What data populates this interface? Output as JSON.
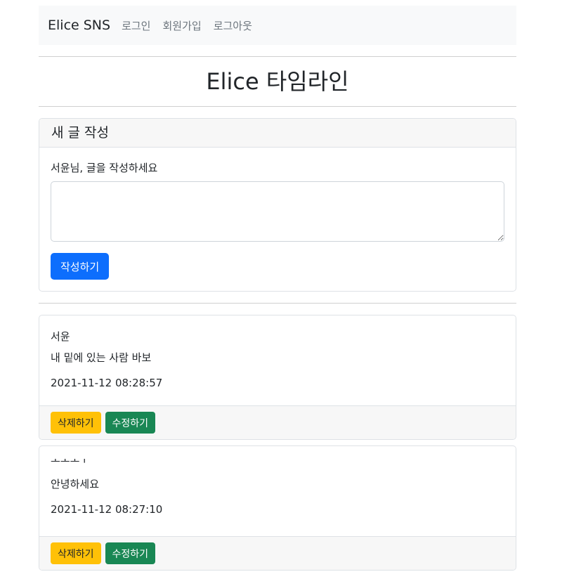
{
  "navbar": {
    "brand": "Elice SNS",
    "links": [
      "로그인",
      "회원가입",
      "로그아웃"
    ]
  },
  "page": {
    "title": "Elice 타임라인"
  },
  "new_post": {
    "header": "새 글 작성",
    "label": "서윤님, 글을 작성하세요",
    "textarea_value": "",
    "submit_label": "작성하기"
  },
  "posts": [
    {
      "author": "서윤",
      "content": "내 밑에 있는 사람 바보",
      "date": "2021-11-12 08:28:57",
      "delete_label": "삭제하기",
      "edit_label": "수정하기"
    },
    {
      "author": "보조도구",
      "content": "안녕하세요",
      "date": "2021-11-12 08:27:10",
      "delete_label": "삭제하기",
      "edit_label": "수정하기"
    }
  ],
  "colors": {
    "primary": "#0d6efd",
    "warning": "#ffc107",
    "success": "#198754",
    "navbar_bg": "#f8f9fa"
  }
}
